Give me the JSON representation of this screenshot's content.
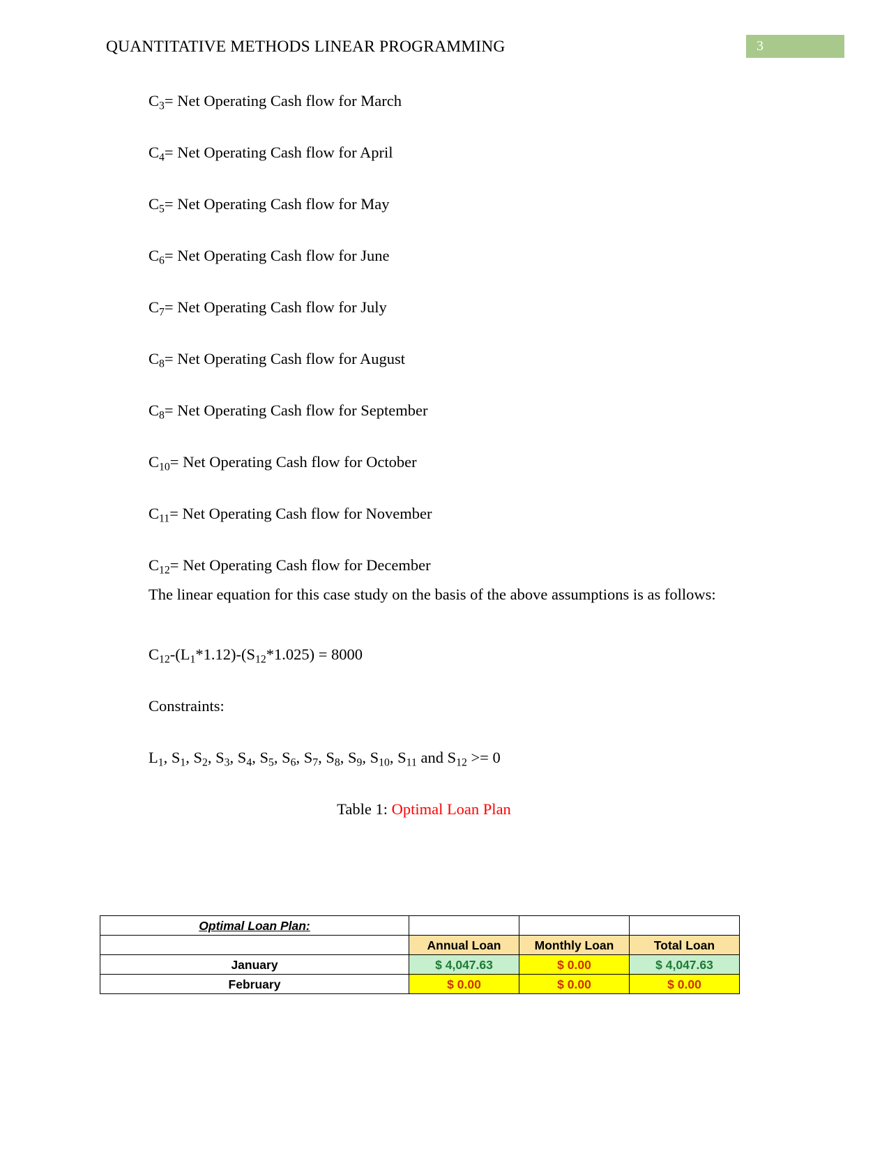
{
  "header": {
    "title": "QUANTITATIVE METHODS LINEAR PROGRAMMING",
    "page_number": "3",
    "badge_color": "#a9c98c"
  },
  "definitions": [
    {
      "symbol": "C",
      "subscript": "3",
      "text": "= Net Operating Cash flow for March"
    },
    {
      "symbol": "C",
      "subscript": "4",
      "text": "= Net Operating Cash flow for April"
    },
    {
      "symbol": "C",
      "subscript": "5",
      "text": "= Net Operating Cash flow for May"
    },
    {
      "symbol": "C",
      "subscript": "6",
      "text": "= Net Operating Cash flow for June"
    },
    {
      "symbol": "C",
      "subscript": "7",
      "text": "= Net Operating Cash flow for July"
    },
    {
      "symbol": "C",
      "subscript": "8",
      "text": "= Net Operating Cash flow for August"
    },
    {
      "symbol": "C",
      "subscript": "8",
      "text": "= Net Operating Cash flow for September"
    },
    {
      "symbol": "C",
      "subscript": "10",
      "text": "= Net Operating Cash flow for October"
    },
    {
      "symbol": "C",
      "subscript": "11",
      "text": "= Net Operating Cash flow for November"
    },
    {
      "symbol": "C",
      "subscript": "12",
      "text": "= Net Operating Cash flow for December"
    }
  ],
  "paragraph": "The linear equation for this case study on the basis of the above assumptions is as follows:",
  "equation": {
    "part1": "C",
    "sub1": "12",
    "part2": "-(L",
    "sub2": "1",
    "part3": "*1.12)-(S",
    "sub3": "12",
    "part4": "*1.025) = 8000"
  },
  "constraints_label": "Constraints:",
  "constraints": {
    "terms": [
      {
        "symbol": "L",
        "subscript": "1"
      },
      {
        "symbol": "S",
        "subscript": "1"
      },
      {
        "symbol": "S",
        "subscript": "2"
      },
      {
        "symbol": "S",
        "subscript": "3"
      },
      {
        "symbol": "S",
        "subscript": "4"
      },
      {
        "symbol": "S",
        "subscript": "5"
      },
      {
        "symbol": "S",
        "subscript": "6"
      },
      {
        "symbol": "S",
        "subscript": "7"
      },
      {
        "symbol": "S",
        "subscript": "8"
      },
      {
        "symbol": "S",
        "subscript": "9"
      },
      {
        "symbol": "S",
        "subscript": "10"
      },
      {
        "symbol": "S",
        "subscript": "11"
      }
    ],
    "conjunction": "and",
    "last_symbol": "S",
    "last_subscript": "12",
    "relation": ">= 0"
  },
  "table_caption": {
    "prefix": "Table 1: ",
    "title": "Optimal Loan Plan",
    "title_color": "#ff0000"
  },
  "loan_table": {
    "title_cell": "Optimal Loan Plan:",
    "columns": [
      "Annual Loan",
      "Monthly Loan",
      "Total Loan"
    ],
    "rows": [
      {
        "month": "January",
        "annual": {
          "value": "$ 4,047.63",
          "style": "green"
        },
        "monthly": {
          "value": "$ 0.00",
          "style": "yellow"
        },
        "total": {
          "value": "$ 4,047.63",
          "style": "green"
        }
      },
      {
        "month": "February",
        "annual": {
          "value": "$ 0.00",
          "style": "yellow"
        },
        "monthly": {
          "value": "$ 0.00",
          "style": "yellow"
        },
        "total": {
          "value": "$ 0.00",
          "style": "yellow"
        }
      }
    ],
    "colors": {
      "header_bg": "#fbe2a0",
      "green_bg": "#c6efce",
      "green_text": "#1d7a34",
      "yellow_bg": "#ffff00",
      "yellow_text": "#cc3300"
    }
  }
}
